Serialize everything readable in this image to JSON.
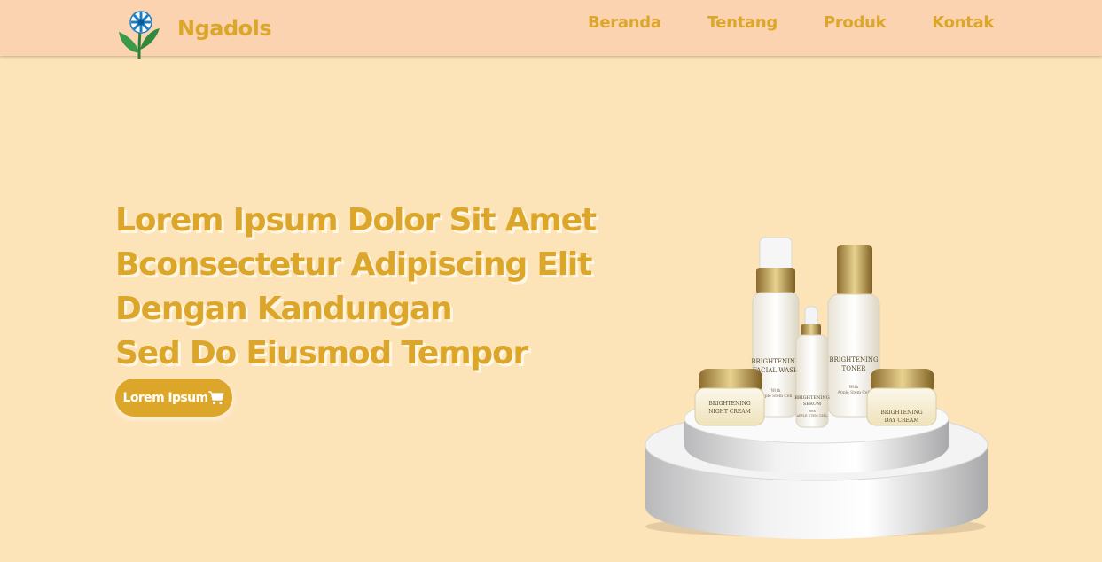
{
  "brand": {
    "name": "Ngadols",
    "logo_icon": "flower-logo-icon"
  },
  "nav": {
    "items": [
      {
        "label": "Beranda"
      },
      {
        "label": "Tentang"
      },
      {
        "label": "Produk"
      },
      {
        "label": "Kontak"
      }
    ]
  },
  "hero": {
    "lines": [
      "Lorem Ipsum Dolor Sit Amet",
      "Bconsectetur Adipiscing Elit",
      "Dengan Kandungan",
      "Sed Do Eiusmod Tempor"
    ],
    "cta_label": "Lorem Ipsum",
    "cta_icon": "shopping-cart-icon"
  },
  "product_image": {
    "products": [
      {
        "line1": "BRIGHTENING",
        "line2": "FACIAL WASH",
        "line3": "With",
        "line4": "Apple Stem Cell"
      },
      {
        "line1": "BRIGHTENING",
        "line2": "TONER",
        "line3": "With",
        "line4": "Apple Stem Cell"
      },
      {
        "line1": "BRIGHTENING",
        "line2": "SERUM",
        "line3": "with",
        "line4": "APPLE STEM CELL"
      },
      {
        "line1": "BRIGHTENING",
        "line2": "NIGHT CREAM"
      },
      {
        "line1": "BRIGHTENING",
        "line2": "DAY CREAM"
      }
    ]
  },
  "colors": {
    "page_background": "#fde3b8",
    "navbar_background": "#fbd3b0",
    "accent": "#dba62a",
    "button_text": "#ffffff"
  }
}
